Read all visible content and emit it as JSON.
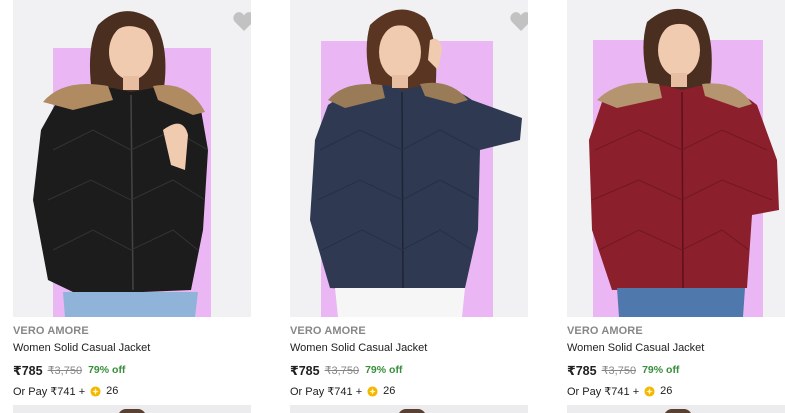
{
  "products": [
    {
      "brand": "VERO AMORE",
      "title": "Women Solid Casual Jacket",
      "price": "₹785",
      "mrp": "₹3,750",
      "discount": "79% off",
      "pay_prefix": "Or Pay ₹741 +",
      "coins": "26",
      "jacket_color": "#1c1c1c",
      "wishlist": true
    },
    {
      "brand": "VERO AMORE",
      "title": "Women Solid Casual Jacket",
      "price": "₹785",
      "mrp": "₹3,750",
      "discount": "79% off",
      "pay_prefix": "Or Pay ₹741 +",
      "coins": "26",
      "jacket_color": "#2f3a52",
      "wishlist": true
    },
    {
      "brand": "VERO AMORE",
      "title": "Women Solid Casual Jacket",
      "price": "₹785",
      "mrp": "₹3,750",
      "discount": "79% off",
      "pay_prefix": "Or Pay ₹741 +",
      "coins": "26",
      "jacket_color": "#8c1f2c",
      "wishlist": false
    }
  ],
  "colors": {
    "card_bg": "#f1f1f3",
    "accent_panel": "#eab6f3",
    "discount": "#388e3c",
    "muted": "#878787",
    "coin": "#f5b800"
  },
  "icons": {
    "wishlist": "heart-icon",
    "supercoin": "supercoin-icon"
  }
}
